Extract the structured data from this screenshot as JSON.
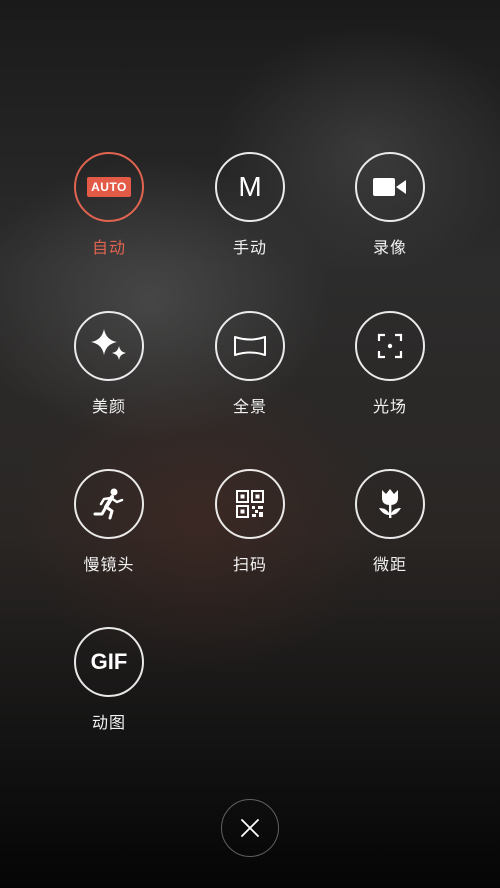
{
  "modes": [
    {
      "id": "auto",
      "label": "自动",
      "icon_text": "AUTO",
      "icon": "auto-icon",
      "active": true
    },
    {
      "id": "manual",
      "label": "手动",
      "icon_text": "M",
      "icon": "manual-m-icon",
      "active": false
    },
    {
      "id": "video",
      "label": "录像",
      "icon": "video-camera-icon",
      "active": false
    },
    {
      "id": "beauty",
      "label": "美颜",
      "icon": "sparkle-icon",
      "active": false
    },
    {
      "id": "panorama",
      "label": "全景",
      "icon": "panorama-icon",
      "active": false
    },
    {
      "id": "light-field",
      "label": "光场",
      "icon": "focus-frame-icon",
      "active": false
    },
    {
      "id": "slow-motion",
      "label": "慢镜头",
      "icon": "running-person-icon",
      "active": false
    },
    {
      "id": "scan",
      "label": "扫码",
      "icon": "qr-code-icon",
      "active": false
    },
    {
      "id": "macro",
      "label": "微距",
      "icon": "tulip-icon",
      "active": false
    },
    {
      "id": "gif",
      "label": "动图",
      "icon_text": "GIF",
      "icon": "gif-icon",
      "active": false
    }
  ],
  "close": {
    "icon": "close-icon"
  },
  "colors": {
    "accent": "#e06450",
    "auto_badge": "#e35a46",
    "text": "#f2f2f2"
  }
}
